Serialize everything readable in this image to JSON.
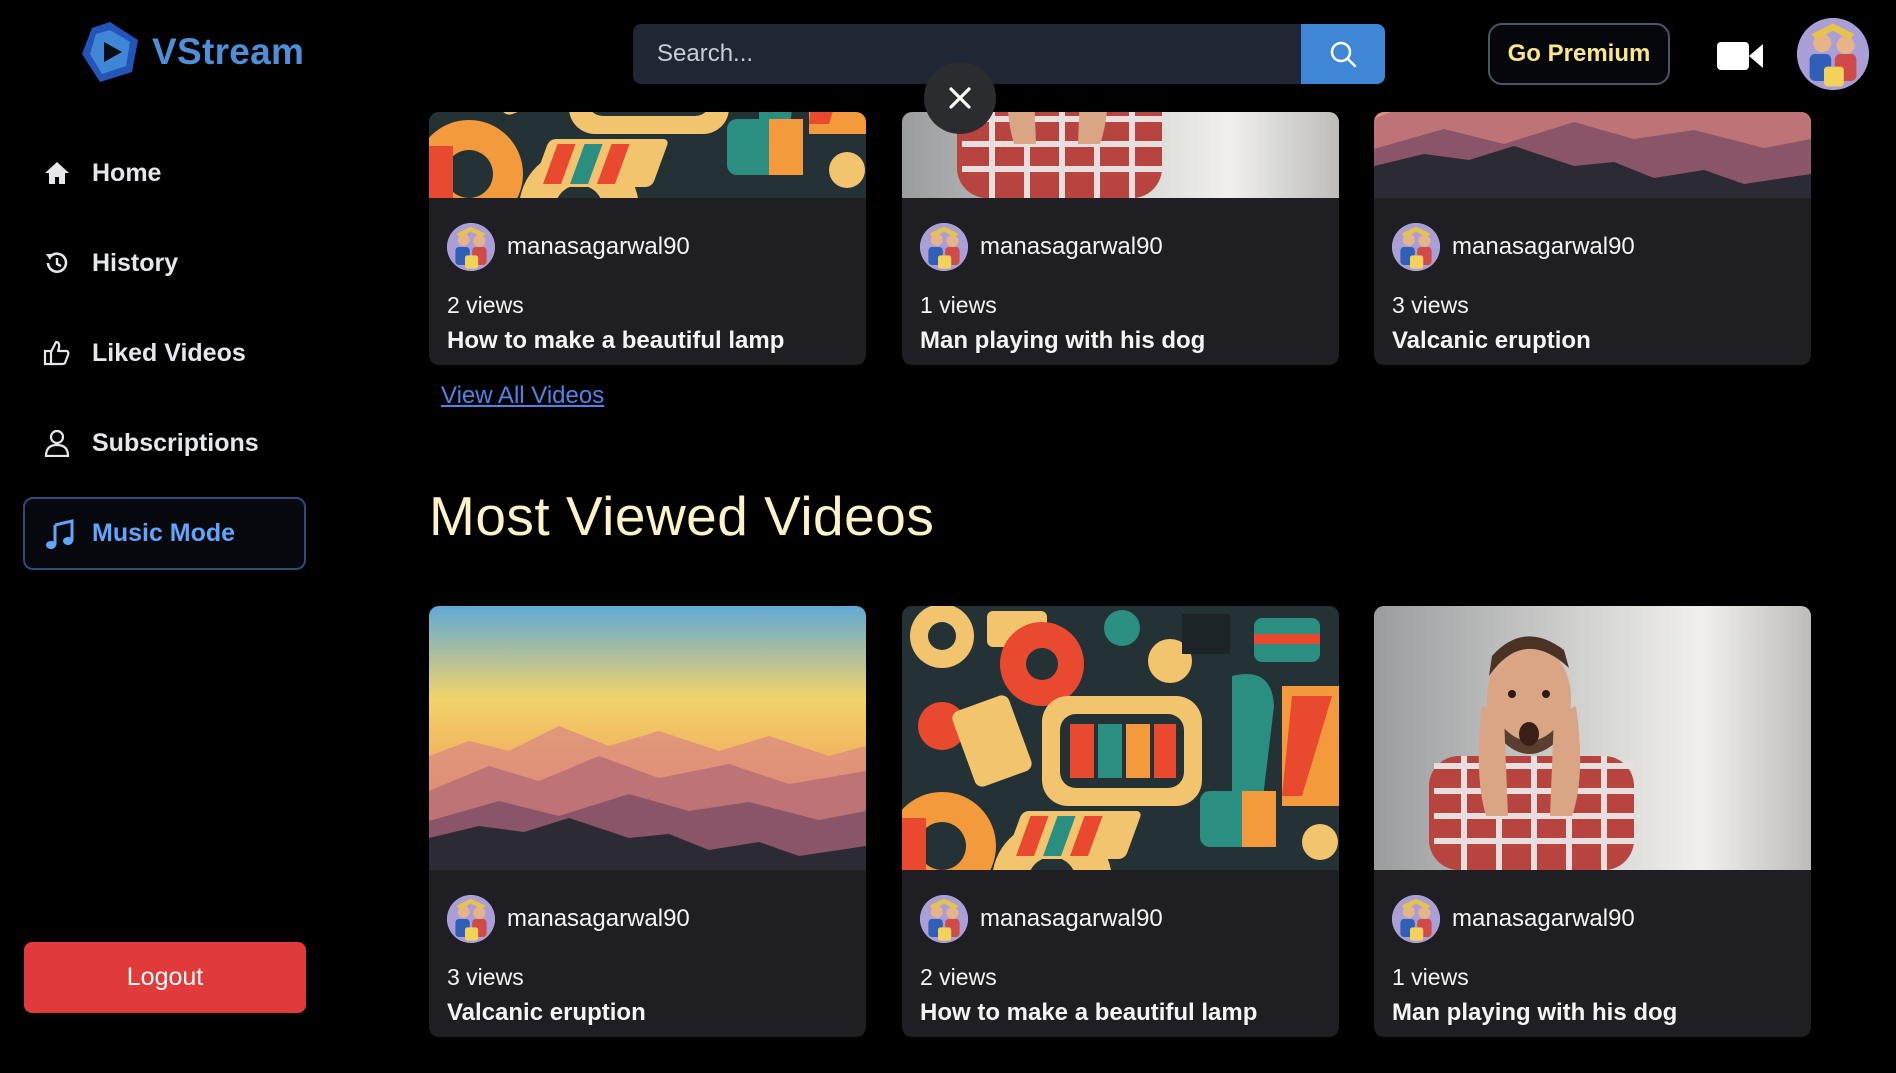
{
  "app": {
    "name": "VStream"
  },
  "search": {
    "placeholder": "Search..."
  },
  "header": {
    "premium_label": "Go Premium"
  },
  "sidebar": {
    "items": [
      {
        "label": "Home",
        "icon": "home-icon"
      },
      {
        "label": "History",
        "icon": "history-icon"
      },
      {
        "label": "Liked Videos",
        "icon": "thumbs-up-icon"
      },
      {
        "label": "Subscriptions",
        "icon": "user-icon"
      },
      {
        "label": "Music Mode",
        "icon": "music-note-icon",
        "active": true
      }
    ],
    "logout_label": "Logout"
  },
  "top_videos": [
    {
      "owner": "manasagarwal90",
      "views": "2 views",
      "title": "How to make a beautiful lamp",
      "thumbnail": "abstract-shapes"
    },
    {
      "owner": "manasagarwal90",
      "views": "1 views",
      "title": "Man playing with his dog",
      "thumbnail": "surprised-man"
    },
    {
      "owner": "manasagarwal90",
      "views": "3 views",
      "title": "Valcanic eruption",
      "thumbnail": "mountain-sunset"
    }
  ],
  "view_all_label": "View All Videos",
  "most_viewed": {
    "title": "Most Viewed Videos",
    "videos": [
      {
        "owner": "manasagarwal90",
        "views": "3 views",
        "title": "Valcanic eruption",
        "thumbnail": "mountain-sunset"
      },
      {
        "owner": "manasagarwal90",
        "views": "2 views",
        "title": "How to make a beautiful lamp",
        "thumbnail": "abstract-shapes"
      },
      {
        "owner": "manasagarwal90",
        "views": "1 views",
        "title": "Man playing with his dog",
        "thumbnail": "surprised-man"
      }
    ]
  },
  "colors": {
    "background": "#000000",
    "accent": "#3f86d6",
    "card": "#1f1f23",
    "premium_text": "#fde68a",
    "section_title": "#fdf2c8",
    "logout": "#e03a3a"
  }
}
